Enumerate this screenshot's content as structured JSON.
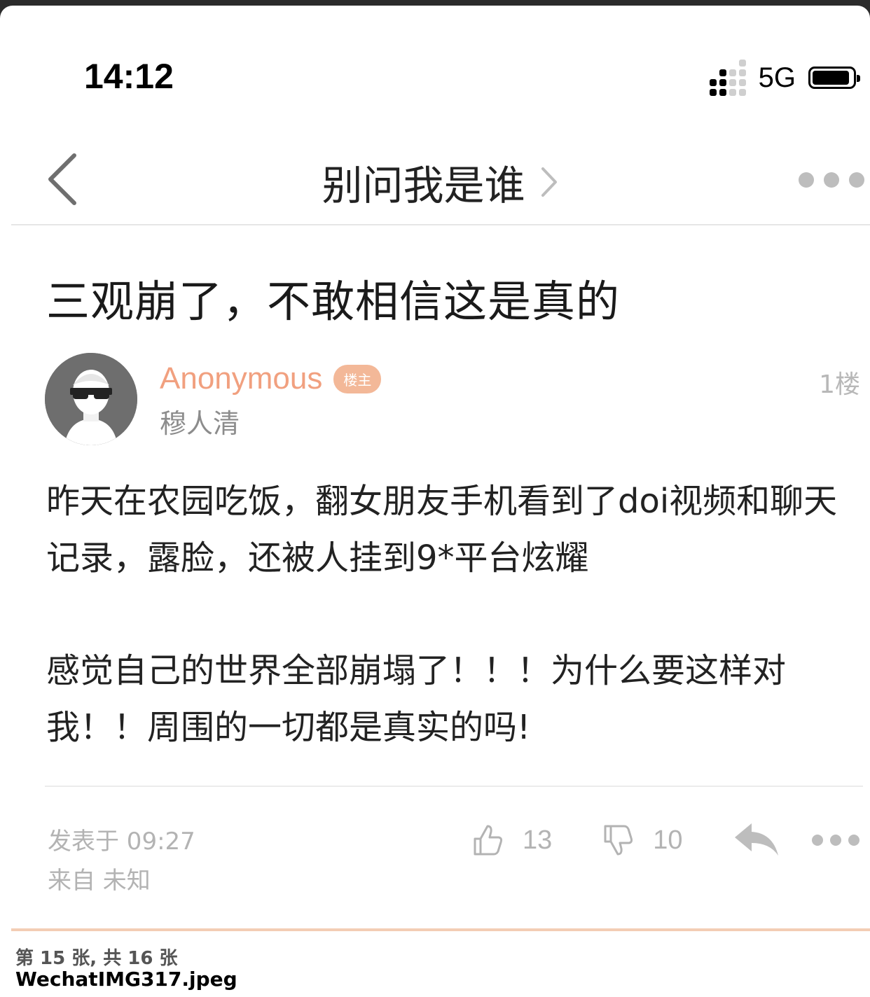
{
  "status_bar": {
    "time": "14:12",
    "network": "5G"
  },
  "nav": {
    "title": "别问我是谁",
    "icons": {
      "back": "chevron-left-icon",
      "forward": "chevron-right-icon",
      "more": "more-dots-icon"
    }
  },
  "post": {
    "title": "三观崩了，不敢相信这是真的",
    "author": {
      "name": "Anonymous",
      "badge": "楼主",
      "subname": "穆人清"
    },
    "floor": "1楼",
    "paragraphs": [
      "昨天在农园吃饭，翻女朋友手机看到了doi视频和聊天记录，露脸，还被人挂到9*平台炫耀",
      "感觉自己的世界全部崩塌了！！！为什么要这样对我！！周围的一切都是真实的吗!"
    ],
    "posted_at": "发表于 09:27",
    "source": "来自 未知",
    "likes": "13",
    "dislikes": "10"
  },
  "colors": {
    "username": "#f1a07f",
    "badge": "#f3b898",
    "divider_accent": "#f3cdb4"
  },
  "caption": {
    "counter": "第 15 张, 共 16 张",
    "filename": "WechatIMG317.jpeg"
  }
}
